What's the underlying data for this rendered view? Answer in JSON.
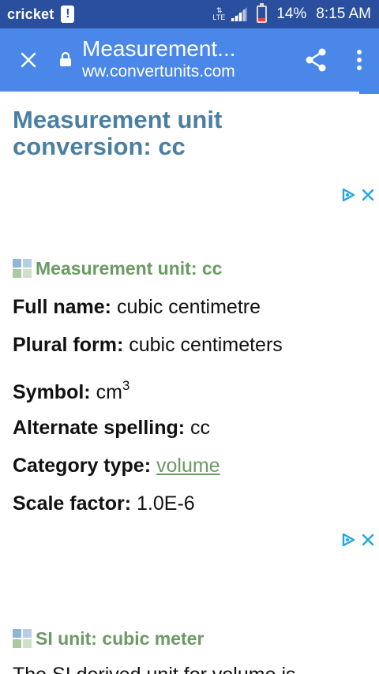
{
  "status_bar": {
    "carrier": "cricket",
    "network": "LTE",
    "battery": "14%",
    "time": "8:15 AM"
  },
  "tab_bar": {
    "title": "Measurement...",
    "url": "ww.convertunits.com"
  },
  "page": {
    "heading": "Measurement unit conversion: cc",
    "section1": "Measurement unit: cc",
    "rows": [
      {
        "label": "Full name:",
        "value": "cubic centimetre"
      },
      {
        "label": "Plural form:",
        "value": "cubic centimeters"
      },
      {
        "label": "Symbol:",
        "value": "cm",
        "sup": "3"
      },
      {
        "label": "Alternate spelling:",
        "value": "cc"
      },
      {
        "label": "Category type:",
        "value": "volume"
      },
      {
        "label": "Scale factor:",
        "value": "1.0E-6"
      }
    ],
    "section2": "SI unit: cubic meter",
    "cut_text": "The SI derived unit for volume is"
  },
  "colors": {
    "status_bar": "#2a4f9e",
    "tab_bar": "#4a87e8",
    "heading": "#4a7fa2",
    "section": "#6b9a63",
    "ad_icon": "#1ea7e0"
  }
}
